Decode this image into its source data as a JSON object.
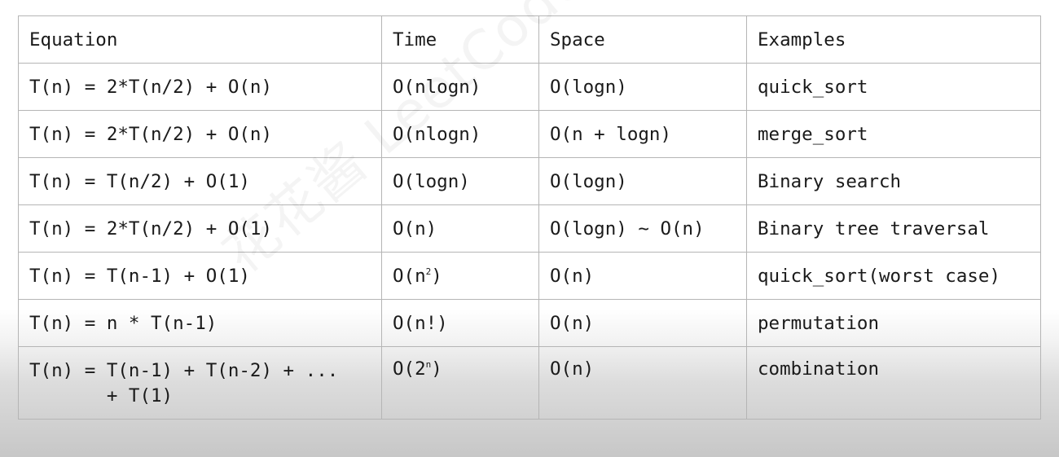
{
  "table": {
    "headers": [
      "Equation",
      "Time",
      "Space",
      "Examples"
    ],
    "rows": [
      {
        "equation": "T(n) = 2*T(n/2) + O(n)",
        "time": "O(nlogn)",
        "time_sup": "",
        "time_end": "",
        "space": "O(logn)",
        "example": "quick_sort"
      },
      {
        "equation": "T(n) = 2*T(n/2) + O(n)",
        "time": "O(nlogn)",
        "time_sup": "",
        "time_end": "",
        "space": "O(n + logn)",
        "example": "merge_sort"
      },
      {
        "equation": "T(n) = T(n/2) + O(1)",
        "time": "O(logn)",
        "time_sup": "",
        "time_end": "",
        "space": "O(logn)",
        "example": "Binary search"
      },
      {
        "equation": "T(n) = 2*T(n/2) + O(1)",
        "time": "O(n)",
        "time_sup": "",
        "time_end": "",
        "space": "O(logn) ~ O(n)",
        "example": "Binary tree traversal"
      },
      {
        "equation": "T(n) = T(n-1) + O(1)",
        "time": "O(n",
        "time_sup": "2",
        "time_end": ")",
        "space": "O(n)",
        "example": "quick_sort(worst case)"
      },
      {
        "equation": "T(n) = n * T(n-1)",
        "time": "O(n!)",
        "time_sup": "",
        "time_end": "",
        "space": "O(n)",
        "example": "permutation"
      },
      {
        "equation": "T(n) = T(n-1) + T(n-2) + ...\n       + T(1)",
        "time": "O(2",
        "time_sup": "n",
        "time_end": ")",
        "space": "O(n)",
        "example": "combination"
      }
    ]
  },
  "watermark": "花花酱 LeetCode https://zxi.mytechroad.com/blog/"
}
